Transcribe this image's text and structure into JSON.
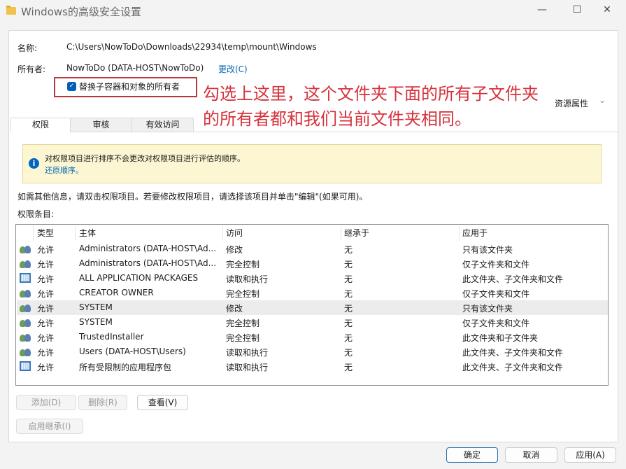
{
  "window": {
    "title": "Windows的高级安全设置",
    "minimize": "—",
    "maximize": "☐",
    "close": "✕"
  },
  "name": {
    "label": "名称:",
    "value": "C:\\Users\\NowToDo\\Downloads\\22934\\temp\\mount\\Windows"
  },
  "owner": {
    "label": "所有者:",
    "value": "NowToDo (DATA-HOST\\NowToDo)",
    "change": "更改(C)"
  },
  "replace_owner": {
    "label": "替换子容器和对象的所有者",
    "checked": true
  },
  "annotation": {
    "line1": "勾选上这里，这个文件夹下面的所有子文件夹",
    "line2": "的所有者都和我们当前文件夹相同。"
  },
  "resource_props": "资源属性",
  "tabs": [
    {
      "label": "权限"
    },
    {
      "label": "审核"
    },
    {
      "label": "有效访问"
    }
  ],
  "info": {
    "text": "对权限项目进行排序不会更改对权限项目进行评估的顺序。",
    "link": "还原顺序。"
  },
  "hint": "如需其他信息，请双击权限项目。若要修改权限项目，请选择该项目并单击\"编辑\"(如果可用)。",
  "entries_label": "权限条目:",
  "columns": [
    "类型",
    "主体",
    "访问",
    "继承于",
    "应用于"
  ],
  "rows": [
    {
      "icon": "user",
      "type": "允许",
      "principal": "Administrators (DATA-HOST\\Ad...",
      "access": "修改",
      "inherit": "无",
      "apply": "只有该文件夹"
    },
    {
      "icon": "user",
      "type": "允许",
      "principal": "Administrators (DATA-HOST\\Ad...",
      "access": "完全控制",
      "inherit": "无",
      "apply": "仅子文件夹和文件"
    },
    {
      "icon": "pkg",
      "type": "允许",
      "principal": "ALL APPLICATION PACKAGES",
      "access": "读取和执行",
      "inherit": "无",
      "apply": "此文件夹、子文件夹和文件"
    },
    {
      "icon": "user",
      "type": "允许",
      "principal": "CREATOR OWNER",
      "access": "完全控制",
      "inherit": "无",
      "apply": "仅子文件夹和文件"
    },
    {
      "icon": "user",
      "type": "允许",
      "principal": "SYSTEM",
      "access": "修改",
      "inherit": "无",
      "apply": "只有该文件夹"
    },
    {
      "icon": "user",
      "type": "允许",
      "principal": "SYSTEM",
      "access": "完全控制",
      "inherit": "无",
      "apply": "仅子文件夹和文件"
    },
    {
      "icon": "user",
      "type": "允许",
      "principal": "TrustedInstaller",
      "access": "完全控制",
      "inherit": "无",
      "apply": "此文件夹和子文件夹"
    },
    {
      "icon": "user",
      "type": "允许",
      "principal": "Users (DATA-HOST\\Users)",
      "access": "读取和执行",
      "inherit": "无",
      "apply": "此文件夹、子文件夹和文件"
    },
    {
      "icon": "pkg",
      "type": "允许",
      "principal": "所有受限制的应用程序包",
      "access": "读取和执行",
      "inherit": "无",
      "apply": "此文件夹、子文件夹和文件"
    }
  ],
  "buttons": {
    "add": "添加(D)",
    "remove": "删除(R)",
    "view": "查看(V)",
    "enable_inherit": "启用继承(I)",
    "ok": "确定",
    "cancel": "取消",
    "apply": "应用(A)"
  }
}
